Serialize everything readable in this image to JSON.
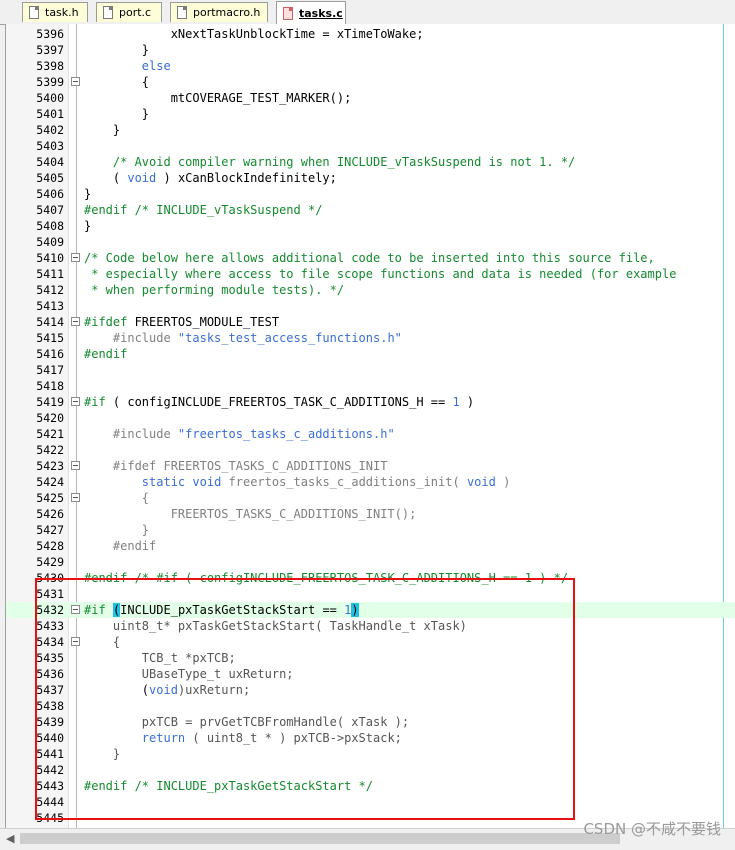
{
  "tabs": [
    {
      "label": "task.h",
      "active": false
    },
    {
      "label": "port.c",
      "active": false
    },
    {
      "label": "portmacro.h",
      "active": false
    },
    {
      "label": "tasks.c",
      "active": true
    }
  ],
  "lines": [
    {
      "n": "5396",
      "segs": [
        {
          "t": "            xNextTaskUnblockTime = xTimeToWake;"
        }
      ]
    },
    {
      "n": "5397",
      "segs": [
        {
          "t": "        }"
        }
      ]
    },
    {
      "n": "5398",
      "segs": [
        {
          "t": "        "
        },
        {
          "t": "else",
          "c": "kw"
        }
      ]
    },
    {
      "n": "5399",
      "fold": true,
      "segs": [
        {
          "t": "        {"
        }
      ]
    },
    {
      "n": "5400",
      "segs": [
        {
          "t": "            mtCOVERAGE_TEST_MARKER();"
        }
      ]
    },
    {
      "n": "5401",
      "segs": [
        {
          "t": "        }"
        }
      ]
    },
    {
      "n": "5402",
      "segs": [
        {
          "t": "    }"
        }
      ]
    },
    {
      "n": "5403",
      "segs": [
        {
          "t": ""
        }
      ]
    },
    {
      "n": "5404",
      "segs": [
        {
          "t": "    "
        },
        {
          "t": "/* Avoid compiler warning when INCLUDE_vTaskSuspend is not 1. */",
          "c": "cm"
        }
      ]
    },
    {
      "n": "5405",
      "segs": [
        {
          "t": "    ( "
        },
        {
          "t": "void",
          "c": "kw"
        },
        {
          "t": " ) xCanBlockIndefinitely;"
        }
      ]
    },
    {
      "n": "5406",
      "segs": [
        {
          "t": "}"
        }
      ]
    },
    {
      "n": "5407",
      "segs": [
        {
          "t": "#endif",
          "c": "pp"
        },
        {
          "t": " /* INCLUDE_vTaskSuspend */",
          "c": "cm"
        }
      ]
    },
    {
      "n": "5408",
      "segs": [
        {
          "t": "}"
        }
      ]
    },
    {
      "n": "5409",
      "segs": [
        {
          "t": ""
        }
      ]
    },
    {
      "n": "5410",
      "fold": true,
      "segs": [
        {
          "t": "/* Code below here allows additional code to be inserted into this source file,",
          "c": "cm"
        }
      ]
    },
    {
      "n": "5411",
      "segs": [
        {
          "t": " * especially where access to file scope functions and data is needed (for example",
          "c": "cm"
        }
      ]
    },
    {
      "n": "5412",
      "segs": [
        {
          "t": " * when performing module tests). */",
          "c": "cm"
        }
      ]
    },
    {
      "n": "5413",
      "segs": [
        {
          "t": ""
        }
      ]
    },
    {
      "n": "5414",
      "fold": true,
      "segs": [
        {
          "t": "#ifdef",
          "c": "pp"
        },
        {
          "t": " FREERTOS_MODULE_TEST"
        }
      ]
    },
    {
      "n": "5415",
      "segs": [
        {
          "t": "    "
        },
        {
          "t": "#include",
          "c": "ppd"
        },
        {
          "t": " \"tasks_test_access_functions.h\"",
          "c": "st"
        }
      ]
    },
    {
      "n": "5416",
      "segs": [
        {
          "t": "#endif",
          "c": "pp"
        }
      ]
    },
    {
      "n": "5417",
      "segs": [
        {
          "t": ""
        }
      ]
    },
    {
      "n": "5418",
      "segs": [
        {
          "t": ""
        }
      ]
    },
    {
      "n": "5419",
      "fold": true,
      "segs": [
        {
          "t": "#if",
          "c": "pp"
        },
        {
          "t": " ( configINCLUDE_FREERTOS_TASK_C_ADDITIONS_H == "
        },
        {
          "t": "1",
          "c": "nm"
        },
        {
          "t": " )"
        }
      ]
    },
    {
      "n": "5420",
      "segs": [
        {
          "t": ""
        }
      ]
    },
    {
      "n": "5421",
      "segs": [
        {
          "t": "    "
        },
        {
          "t": "#include",
          "c": "ppd"
        },
        {
          "t": " \"freertos_tasks_c_additions.h\"",
          "c": "st"
        }
      ]
    },
    {
      "n": "5422",
      "segs": [
        {
          "t": ""
        }
      ]
    },
    {
      "n": "5423",
      "fold": true,
      "segs": [
        {
          "t": "    "
        },
        {
          "t": "#ifdef FREERTOS_TASKS_C_ADDITIONS_INIT",
          "c": "ppd"
        }
      ]
    },
    {
      "n": "5424",
      "segs": [
        {
          "t": "        "
        },
        {
          "t": "static",
          "c": "kw"
        },
        {
          "t": " "
        },
        {
          "t": "void",
          "c": "kw"
        },
        {
          "t": " freertos_tasks_c_additions_init( ",
          "c": "ppd"
        },
        {
          "t": "void",
          "c": "kw"
        },
        {
          "t": " )",
          "c": "ppd"
        }
      ]
    },
    {
      "n": "5425",
      "fold": true,
      "segs": [
        {
          "t": "        {",
          "c": "ppd"
        }
      ]
    },
    {
      "n": "5426",
      "segs": [
        {
          "t": "            FREERTOS_TASKS_C_ADDITIONS_INIT();",
          "c": "ppd"
        }
      ]
    },
    {
      "n": "5427",
      "segs": [
        {
          "t": "        }",
          "c": "ppd"
        }
      ]
    },
    {
      "n": "5428",
      "segs": [
        {
          "t": "    "
        },
        {
          "t": "#endif",
          "c": "ppd"
        }
      ]
    },
    {
      "n": "5429",
      "segs": [
        {
          "t": ""
        }
      ]
    },
    {
      "n": "5430",
      "segs": [
        {
          "t": "#endif",
          "c": "pp"
        },
        {
          "t": " /* #if ( configINCLUDE_FREERTOS_TASK_C_ADDITIONS_H == 1 ) */",
          "c": "cm"
        }
      ]
    },
    {
      "n": "5431",
      "segs": [
        {
          "t": ""
        }
      ]
    },
    {
      "n": "5432",
      "fold": true,
      "hl": true,
      "segs": [
        {
          "t": "#if",
          "c": "pp"
        },
        {
          "t": " "
        },
        {
          "t": "(",
          "c": "mark"
        },
        {
          "t": "INCLUDE_pxTaskGetStackStart == "
        },
        {
          "t": "1",
          "c": "nm"
        },
        {
          "t": ")",
          "c": "mark"
        }
      ]
    },
    {
      "n": "5433",
      "segs": [
        {
          "t": "    uint8_t* pxTaskGetStackStart( TaskHandle_t xTask)",
          "c": "gr"
        }
      ]
    },
    {
      "n": "5434",
      "fold": true,
      "segs": [
        {
          "t": "    {",
          "c": "gr"
        }
      ]
    },
    {
      "n": "5435",
      "segs": [
        {
          "t": "        TCB_t *pxTCB;",
          "c": "gr"
        }
      ]
    },
    {
      "n": "5436",
      "segs": [
        {
          "t": "        UBaseType_t uxReturn;",
          "c": "gr"
        }
      ]
    },
    {
      "n": "5437",
      "segs": [
        {
          "t": "        ("
        },
        {
          "t": "void",
          "c": "kw"
        },
        {
          "t": ")uxReturn;",
          "c": "gr"
        }
      ]
    },
    {
      "n": "5438",
      "segs": [
        {
          "t": ""
        }
      ]
    },
    {
      "n": "5439",
      "segs": [
        {
          "t": "        pxTCB = prvGetTCBFromHandle( xTask );",
          "c": "gr"
        }
      ]
    },
    {
      "n": "5440",
      "segs": [
        {
          "t": "        "
        },
        {
          "t": "return",
          "c": "kw"
        },
        {
          "t": " ( uint8_t * ) pxTCB->pxStack;",
          "c": "gr"
        }
      ]
    },
    {
      "n": "5441",
      "segs": [
        {
          "t": "    }",
          "c": "gr"
        }
      ]
    },
    {
      "n": "5442",
      "segs": [
        {
          "t": ""
        }
      ]
    },
    {
      "n": "5443",
      "segs": [
        {
          "t": "#endif",
          "c": "pp"
        },
        {
          "t": " /* INCLUDE_pxTaskGetStackStart */",
          "c": "cm"
        }
      ]
    },
    {
      "n": "5444",
      "segs": [
        {
          "t": ""
        }
      ]
    },
    {
      "n": "5445",
      "segs": [
        {
          "t": ""
        }
      ]
    }
  ],
  "watermark": "CSDN @不咸不要钱"
}
